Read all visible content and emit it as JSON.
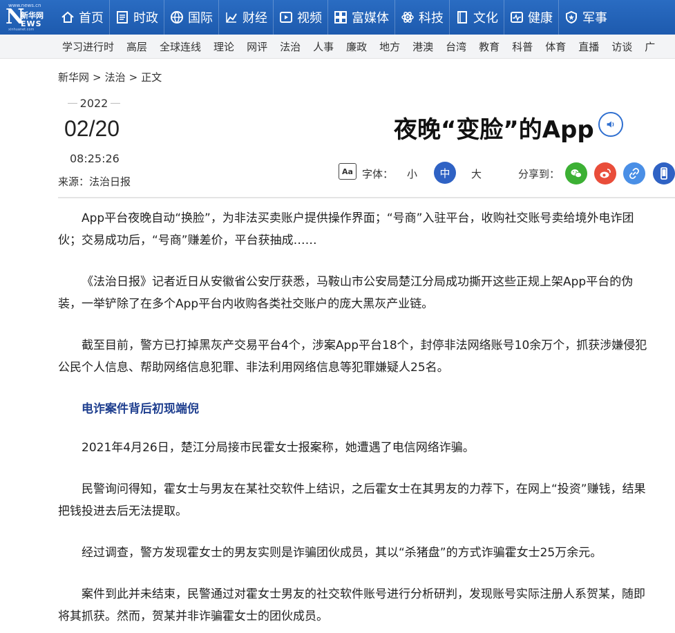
{
  "logo": {
    "site": "www.news.cn",
    "cn": "新华网",
    "n": "N",
    "ews": "EWS",
    "tiny": "xinhuanet.com"
  },
  "nav": [
    {
      "label": "首页",
      "icon": "home-icon"
    },
    {
      "label": "时政",
      "icon": "news-icon"
    },
    {
      "label": "国际",
      "icon": "globe-icon"
    },
    {
      "label": "财经",
      "icon": "chart-icon"
    },
    {
      "label": "视频",
      "icon": "play-icon"
    },
    {
      "label": "富媒体",
      "icon": "grid-icon"
    },
    {
      "label": "科技",
      "icon": "atom-icon"
    },
    {
      "label": "文化",
      "icon": "book-icon"
    },
    {
      "label": "健康",
      "icon": "pulse-icon"
    },
    {
      "label": "军事",
      "icon": "shield-icon"
    }
  ],
  "subnav": [
    "学习进行时",
    "高层",
    "全球连线",
    "理论",
    "网评",
    "法治",
    "人事",
    "廉政",
    "地方",
    "港澳",
    "台湾",
    "教育",
    "科普",
    "体育",
    "直播",
    "访谈",
    "广"
  ],
  "breadcrumb": {
    "home": "新华网",
    "section": "法治",
    "current": "正文",
    "sep": ">"
  },
  "meta": {
    "year": "2022",
    "day": "02/20",
    "time": "08:25:26",
    "source": "来源：法治日报"
  },
  "title": "夜晚“变脸”的App",
  "tools": {
    "aa": "Aa",
    "font_label": "字体：",
    "small": "小",
    "mid": "中",
    "large": "大",
    "share_label": "分享到："
  },
  "article": {
    "p1": "App平台夜晚自动“换脸”，为非法买卖账户提供操作界面；“号商”入驻平台，收购社交账号卖给境外电诈团伙；交易成功后，“号商”赚差价，平台获抽成……",
    "p2": "《法治日报》记者近日从安徽省公安厅获悉，马鞍山市公安局楚江分局成功撕开这些正规上架App平台的伪装，一举铲除了在多个App平台内收购各类社交账户的庞大黑灰产业链。",
    "p3": "截至目前，警方已打掉黑灰产交易平台4个，涉案App平台18个，封停非法网络账号10余万个，抓获涉嫌侵犯公民个人信息、帮助网络信息犯罪、非法利用网络信息等犯罪嫌疑人25名。",
    "heading": "电诈案件背后初现端倪",
    "p4": "2021年4月26日，楚江分局接市民霍女士报案称，她遭遇了电信网络诈骗。",
    "p5": "民警询问得知，霍女士与男友在某社交软件上结识，之后霍女士在其男友的力荐下，在网上“投资”赚钱，结果把钱投进去后无法提取。",
    "p6": "经过调查，警方发现霍女士的男友实则是诈骗团伙成员，其以“杀猪盘”的方式诈骗霍女士25万余元。",
    "p7": "案件到此并未结束，民警通过对霍女士男友的社交软件账号进行分析研判，发现账号实际注册人系贺某，随即将其抓获。然而，贺某并非诈骗霍女士的团伙成员。"
  }
}
